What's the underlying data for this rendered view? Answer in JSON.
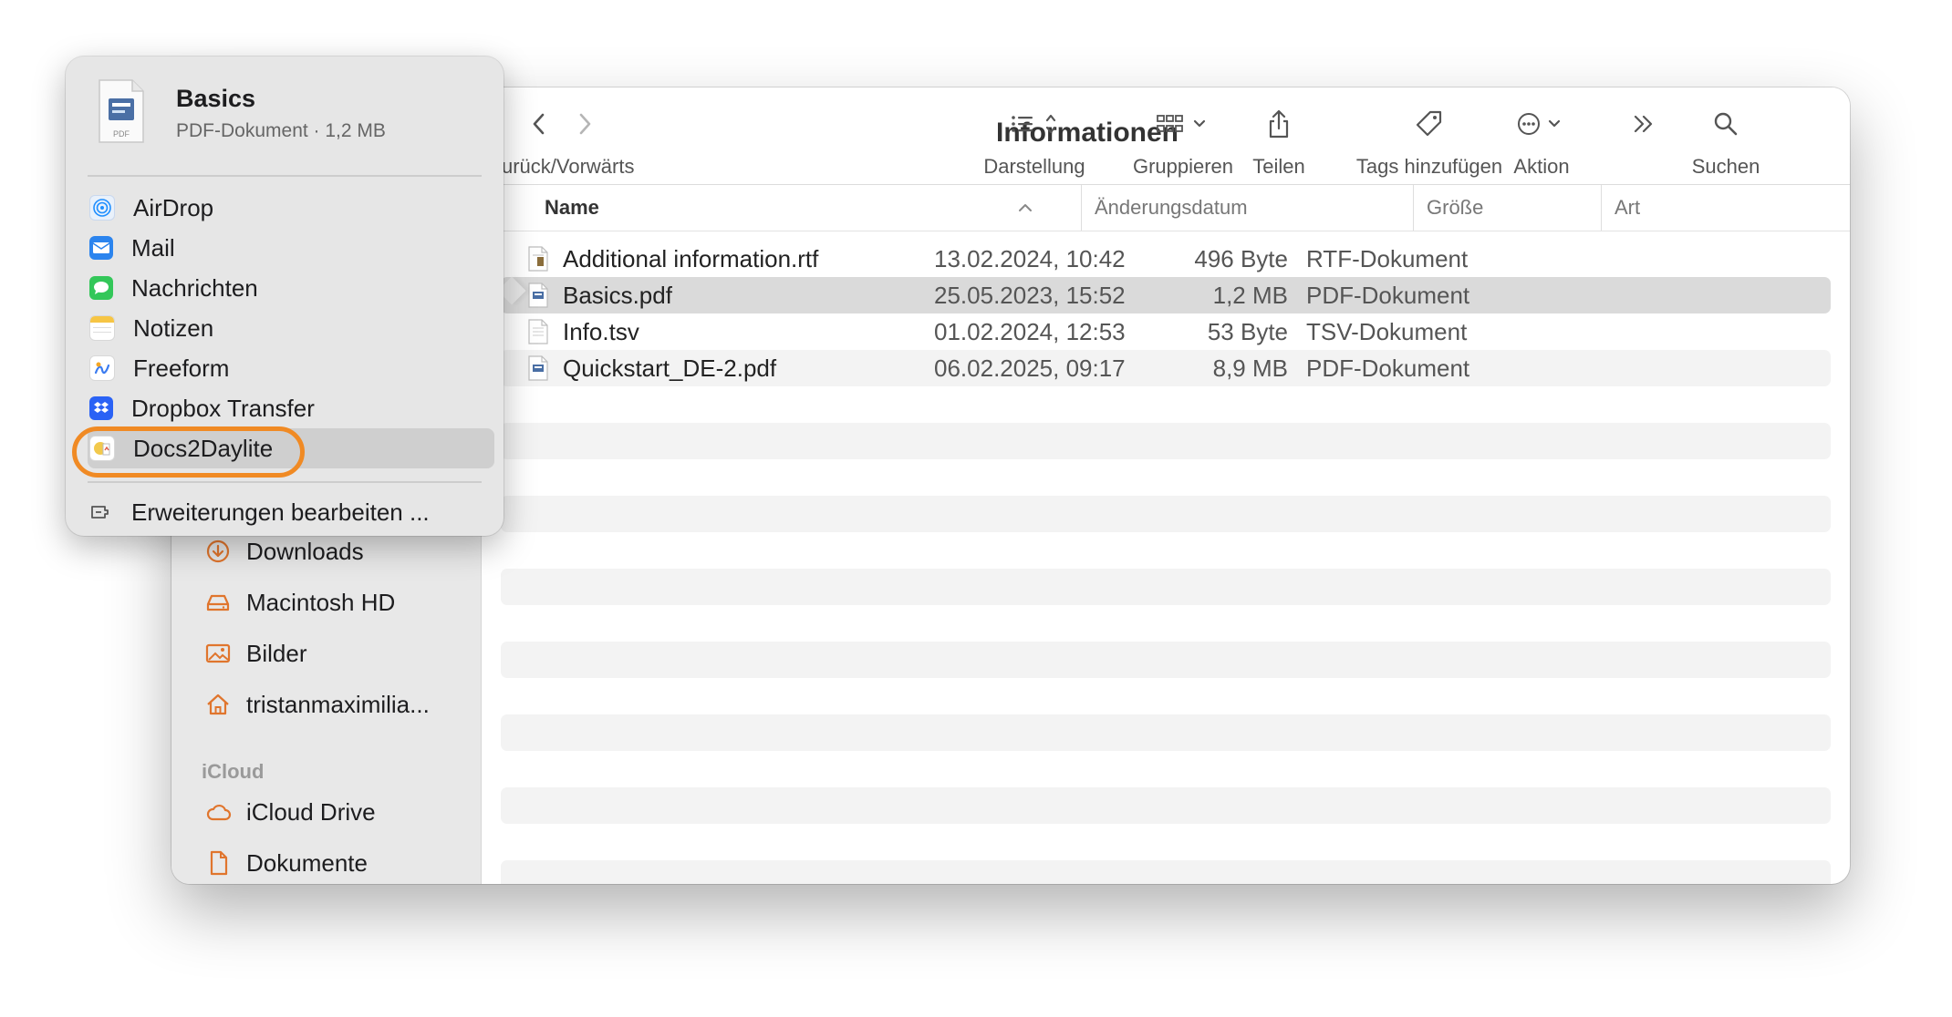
{
  "popover": {
    "file_name": "Basics",
    "file_info": "PDF-Dokument · 1,2 MB",
    "file_icon_caption": "PDF",
    "items": [
      {
        "label": "AirDrop",
        "icon": "airdrop-icon",
        "color": "#1f8fff"
      },
      {
        "label": "Mail",
        "icon": "mail-icon",
        "color": "#2b84ee"
      },
      {
        "label": "Nachrichten",
        "icon": "messages-icon",
        "color": "#33c759"
      },
      {
        "label": "Notizen",
        "icon": "notes-icon",
        "color": "#f6c544"
      },
      {
        "label": "Freeform",
        "icon": "freeform-icon",
        "color": "#3a7bf0"
      },
      {
        "label": "Dropbox Transfer",
        "icon": "dropbox-icon",
        "color": "#2a62f5"
      },
      {
        "label": "Docs2Daylite",
        "icon": "docs2daylite-icon",
        "color": "#f2c94c"
      }
    ],
    "edit_extensions": "Erweiterungen bearbeiten ...",
    "highlight_color": "#f08a24"
  },
  "toolbar": {
    "back_forward": "Zurück/Vorwärts",
    "title": "Informationen",
    "view": "Darstellung",
    "group": "Gruppieren",
    "share": "Teilen",
    "tags": "Tags hinzufügen",
    "action": "Aktion",
    "search": "Suchen"
  },
  "columns": {
    "name": "Name",
    "date": "Änderungsdatum",
    "size": "Größe",
    "kind": "Art"
  },
  "files": [
    {
      "name": "Additional information.rtf",
      "date": "13.02.2024, 10:42",
      "size": "496 Byte",
      "kind": "RTF-Dokument",
      "icon": "rtf-file-icon"
    },
    {
      "name": "Basics.pdf",
      "date": "25.05.2023, 15:52",
      "size": "1,2 MB",
      "kind": "PDF-Dokument",
      "icon": "pdf-file-icon",
      "selected": true
    },
    {
      "name": "Info.tsv",
      "date": "01.02.2024, 12:53",
      "size": "53 Byte",
      "kind": "TSV-Dokument",
      "icon": "tsv-file-icon"
    },
    {
      "name": "Quickstart_DE-2.pdf",
      "date": "06.02.2025, 09:17",
      "size": "8,9 MB",
      "kind": "PDF-Dokument",
      "icon": "pdf-file-icon"
    }
  ],
  "sidebar": {
    "items": [
      {
        "label": "Downloads",
        "icon": "downloads-icon"
      },
      {
        "label": "Macintosh HD",
        "icon": "drive-icon"
      },
      {
        "label": "Bilder",
        "icon": "pictures-icon"
      },
      {
        "label": "tristanmaximilia...",
        "icon": "home-icon"
      }
    ],
    "icloud_heading": "iCloud",
    "icloud_items": [
      {
        "label": "iCloud Drive",
        "icon": "icloud-icon"
      },
      {
        "label": "Dokumente",
        "icon": "documents-icon"
      }
    ],
    "accent": "#e0752d"
  }
}
